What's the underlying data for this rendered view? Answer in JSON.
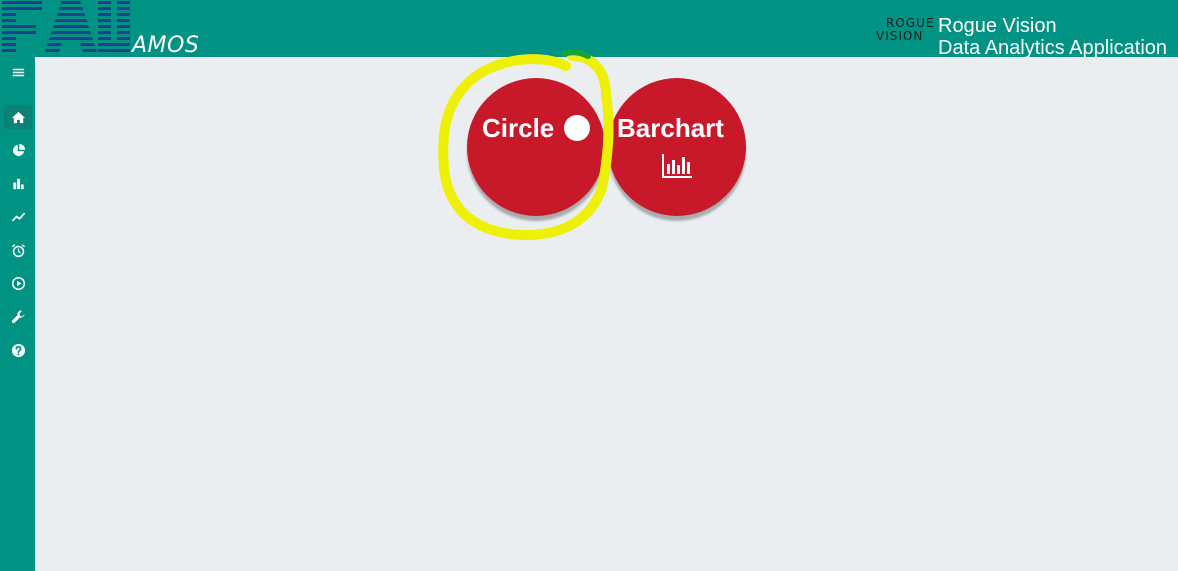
{
  "header": {
    "logo_text": "FAU",
    "app_name": "AMOS",
    "rv_logo_line1": "ROGUE",
    "rv_logo_line2": "VISION",
    "title_line1": "Rogue Vision",
    "title_line2": "Data Analytics Application",
    "background_color": "#009384"
  },
  "sidebar": {
    "items": [
      {
        "icon": "menu-icon",
        "active": false
      },
      {
        "icon": "home-icon",
        "active": true
      },
      {
        "icon": "pie-chart-icon",
        "active": false
      },
      {
        "icon": "bar-chart-icon",
        "active": false
      },
      {
        "icon": "line-chart-icon",
        "active": false
      },
      {
        "icon": "alarm-clock-icon",
        "active": false
      },
      {
        "icon": "play-circle-icon",
        "active": false
      },
      {
        "icon": "wrench-icon",
        "active": false
      },
      {
        "icon": "help-icon",
        "active": false
      }
    ]
  },
  "main": {
    "buttons": [
      {
        "label": "Circle",
        "icon": "circle-icon",
        "highlighted": true
      },
      {
        "label": "Barchart",
        "icon": "bar-chart-icon",
        "highlighted": false
      }
    ],
    "button_color": "#c8192a",
    "highlight_color": "#eef008"
  }
}
